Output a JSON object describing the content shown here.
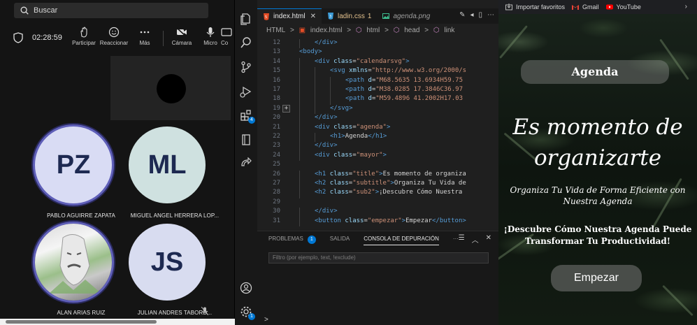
{
  "teams": {
    "search_placeholder": "Buscar",
    "timer": "02:28:59",
    "controls": [
      {
        "label": "Participar",
        "icon": "raise-hand-icon"
      },
      {
        "label": "Reaccionar",
        "icon": "smile-icon"
      },
      {
        "label": "Más",
        "icon": "more-icon"
      },
      {
        "label": "Cámara",
        "icon": "camera-off-icon"
      },
      {
        "label": "Micro",
        "icon": "mic-icon"
      },
      {
        "label": "Co",
        "icon": "share-icon"
      }
    ],
    "participants": [
      {
        "initials": "PZ",
        "name": "PABLO AGUIRRE ZAPATA",
        "bg": "#d9dcf4"
      },
      {
        "initials": "ML",
        "name": "MIGUEL ANGEL HERRERA LOP...",
        "bg": "#cfe1e0"
      },
      {
        "initials": "",
        "name": "ALAN ARIAS RUIZ",
        "bg": "#cccccc"
      },
      {
        "initials": "JS",
        "name": "JULIAN ANDRES TABORD...",
        "bg": "#d8dcf0"
      }
    ]
  },
  "vscode": {
    "tabs": [
      {
        "name": "index.html",
        "active": true,
        "icon_color": "#e44d26"
      },
      {
        "name": "ladin.css",
        "modified": "1",
        "icon_color": "#3c9cd7"
      },
      {
        "name": "agenda.png",
        "icon_color": "#3dbd8f"
      }
    ],
    "breadcrumbs": [
      "HTML",
      ">",
      "index.html",
      ">",
      "html",
      ">",
      "head",
      ">",
      "link"
    ],
    "lines": [
      {
        "n": "12",
        "indent": 1,
        "parts": [
          [
            "tag",
            "</div>"
          ]
        ]
      },
      {
        "n": "13",
        "indent": 0,
        "parts": [
          [
            "tag",
            "<body>"
          ]
        ]
      },
      {
        "n": "14",
        "indent": 1,
        "parts": [
          [
            "tag",
            "<div "
          ],
          [
            "attr",
            "class"
          ],
          [
            "txt",
            "="
          ],
          [
            "str",
            "\"calendarsvg\""
          ],
          [
            "tag",
            ">"
          ]
        ]
      },
      {
        "n": "15",
        "indent": 2,
        "parts": [
          [
            "tag",
            "<svg "
          ],
          [
            "attr",
            "xmlns"
          ],
          [
            "txt",
            "="
          ],
          [
            "str",
            "\"http://www.w3.org/2000/s"
          ]
        ]
      },
      {
        "n": "16",
        "indent": 3,
        "parts": [
          [
            "tag",
            "<path "
          ],
          [
            "attr",
            "d"
          ],
          [
            "txt",
            "="
          ],
          [
            "str",
            "\"M68.5635 13.6934H59.75"
          ]
        ]
      },
      {
        "n": "17",
        "indent": 3,
        "parts": [
          [
            "tag",
            "<path "
          ],
          [
            "attr",
            "d"
          ],
          [
            "txt",
            "="
          ],
          [
            "str",
            "\"M38.0285 17.3846C36.97"
          ]
        ]
      },
      {
        "n": "18",
        "indent": 3,
        "parts": [
          [
            "tag",
            "<path "
          ],
          [
            "attr",
            "d"
          ],
          [
            "txt",
            "="
          ],
          [
            "str",
            "\"M59.4896 41.2002H17.03"
          ]
        ]
      },
      {
        "n": "19",
        "indent": 2,
        "parts": [
          [
            "tag",
            "</svg>"
          ]
        ]
      },
      {
        "n": "20",
        "indent": 1,
        "parts": [
          [
            "tag",
            "</div>"
          ]
        ]
      },
      {
        "n": "21",
        "indent": 1,
        "parts": [
          [
            "tag",
            "<div "
          ],
          [
            "attr",
            "class"
          ],
          [
            "txt",
            "="
          ],
          [
            "str",
            "\"agenda\""
          ],
          [
            "tag",
            ">"
          ]
        ]
      },
      {
        "n": "22",
        "indent": 2,
        "parts": [
          [
            "tag",
            "<h1>"
          ],
          [
            "txt",
            "Agenda"
          ],
          [
            "tag",
            "</h1>"
          ]
        ]
      },
      {
        "n": "23",
        "indent": 1,
        "parts": [
          [
            "tag",
            "</div>"
          ]
        ]
      },
      {
        "n": "24",
        "indent": 1,
        "parts": [
          [
            "tag",
            "<div "
          ],
          [
            "attr",
            "class"
          ],
          [
            "txt",
            "="
          ],
          [
            "str",
            "\"mayor\""
          ],
          [
            "tag",
            ">"
          ]
        ]
      },
      {
        "n": "25",
        "indent": 0,
        "parts": []
      },
      {
        "n": "26",
        "indent": 1,
        "parts": [
          [
            "tag",
            "<h1 "
          ],
          [
            "attr",
            "class"
          ],
          [
            "txt",
            "="
          ],
          [
            "str",
            "\"title\""
          ],
          [
            "tag",
            ">"
          ],
          [
            "txt",
            "Es momento de organiza"
          ]
        ]
      },
      {
        "n": "27",
        "indent": 1,
        "parts": [
          [
            "tag",
            "<h2 "
          ],
          [
            "attr",
            "class"
          ],
          [
            "txt",
            "="
          ],
          [
            "str",
            "\"subtitle\""
          ],
          [
            "tag",
            ">"
          ],
          [
            "txt",
            "Organiza Tu Vida de"
          ]
        ]
      },
      {
        "n": "28",
        "indent": 1,
        "parts": [
          [
            "tag",
            "<h2 "
          ],
          [
            "attr",
            "class"
          ],
          [
            "txt",
            "="
          ],
          [
            "str",
            "\"sub2\""
          ],
          [
            "tag",
            ">"
          ],
          [
            "txt",
            "¡Descubre Cómo Nuestra"
          ]
        ]
      },
      {
        "n": "29",
        "indent": 0,
        "parts": []
      },
      {
        "n": "30",
        "indent": 1,
        "parts": [
          [
            "tag",
            "</div>"
          ]
        ]
      },
      {
        "n": "31",
        "indent": 1,
        "parts": [
          [
            "tag",
            "<button "
          ],
          [
            "attr",
            "class"
          ],
          [
            "txt",
            "="
          ],
          [
            "str",
            "\"empezar\""
          ],
          [
            "tag",
            ">"
          ],
          [
            "txt",
            "Empezar"
          ],
          [
            "tag",
            "</button>"
          ]
        ]
      }
    ],
    "panel": {
      "tabs": [
        "PROBLEMAS",
        "SALIDA",
        "CONSOLA DE DEPURACIÓN"
      ],
      "problems_count": "1",
      "filter_placeholder": "Filtro (por ejemplo, text, !exclude)",
      "prompt": ">"
    },
    "extensions_badge": "4",
    "settings_badge": "1"
  },
  "browser": {
    "bookmarks": [
      {
        "label": "Importar favoritos",
        "icon": "import-icon",
        "color": "#bfbfbf"
      },
      {
        "label": "Gmail",
        "icon": "gmail-icon",
        "color": "#ea4335"
      },
      {
        "label": "YouTube",
        "icon": "youtube-icon",
        "color": "#ff0000"
      }
    ],
    "page": {
      "agenda": "Agenda",
      "title": "Es momento de organizarte",
      "subtitle": "Organiza Tu Vida de Forma Eficiente con Nuestra Agenda",
      "sub2": "¡Descubre Cómo Nuestra Agenda Puede Transformar Tu Productividad!",
      "button": "Empezar"
    }
  }
}
